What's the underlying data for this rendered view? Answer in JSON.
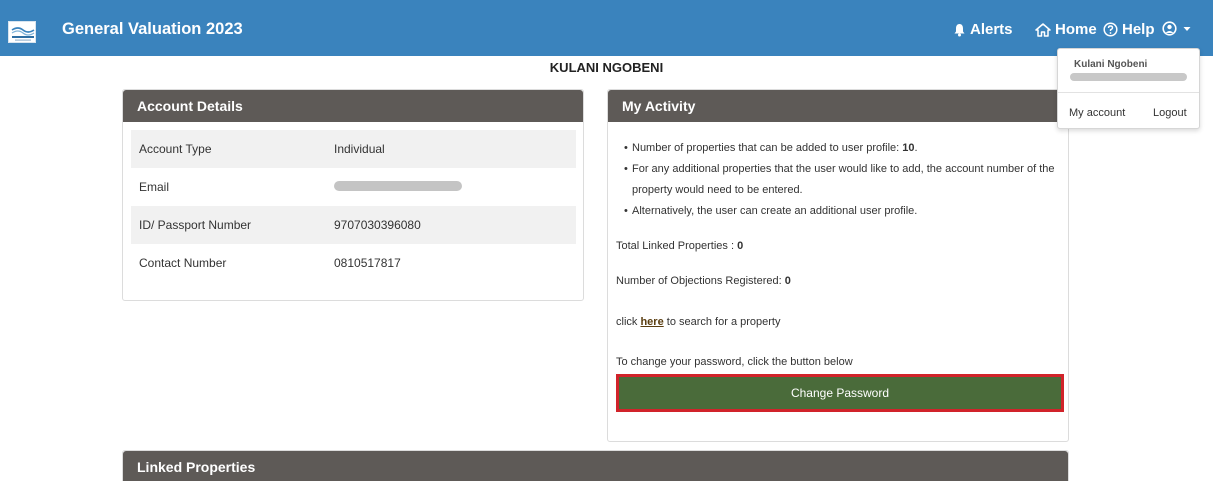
{
  "header": {
    "logo_icon": "municipality-logo",
    "title": "General Valuation 2023",
    "nav": {
      "alerts": "Alerts",
      "home": "Home",
      "help": "Help"
    },
    "colors": {
      "navbar": "#3a83bd"
    }
  },
  "user": {
    "display_name": "KULANI NGOBENI"
  },
  "user_menu": {
    "name": "Kulani Ngobeni",
    "my_account": "My account",
    "logout": "Logout"
  },
  "account_details": {
    "heading": "Account Details",
    "rows": [
      {
        "label": "Account Type",
        "value": "Individual"
      },
      {
        "label": "Email",
        "value": ""
      },
      {
        "label": "ID/ Passport Number",
        "value": "9707030396080"
      },
      {
        "label": "Contact Number",
        "value": "0810517817"
      }
    ]
  },
  "activity": {
    "heading": "My Activity",
    "bullets": {
      "b1_prefix": "Number of properties that can be added to user profile: ",
      "b1_value": "10",
      "b1_suffix": ".",
      "b2": "For any additional properties that the user would like to add, the account number of the property would need to be entered.",
      "b3": "Alternatively, the user can create an additional user profile."
    },
    "total_linked_label": "Total Linked Properties : ",
    "total_linked_value": "0",
    "objections_label": "Number of Objections Registered: ",
    "objections_value": "0",
    "search_prefix": "click ",
    "search_link": "here",
    "search_suffix": " to search for a property",
    "password_hint": "To change your password, click the button below",
    "change_password_button": "Change Password",
    "colors": {
      "button": "#4a6b3a",
      "button_highlight_border": "#d1232a"
    }
  },
  "linked_properties": {
    "heading": "Linked Properties"
  }
}
